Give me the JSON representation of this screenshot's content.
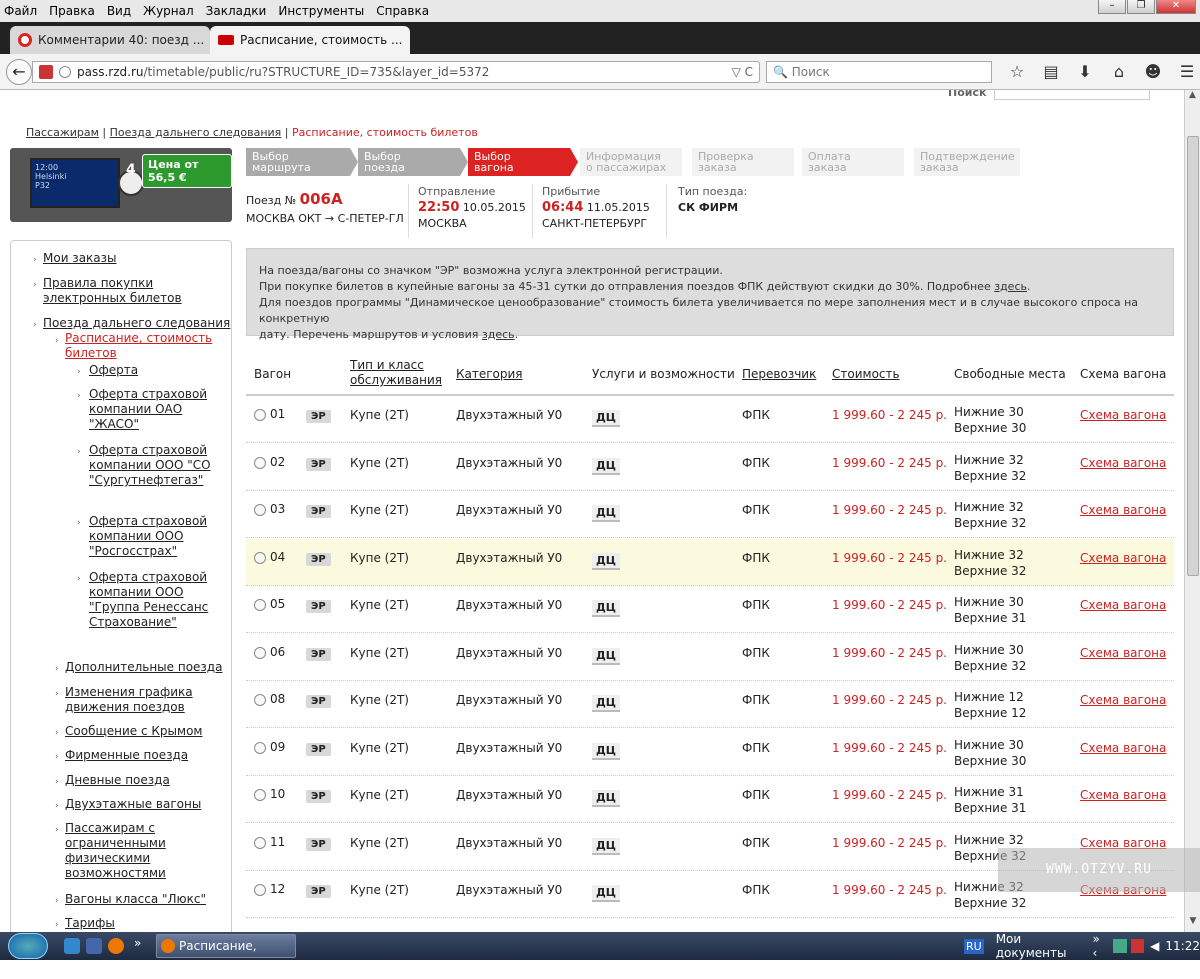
{
  "browser": {
    "menu": [
      "Файл",
      "Правка",
      "Вид",
      "Журнал",
      "Закладки",
      "Инструменты",
      "Справка"
    ],
    "tabs": [
      {
        "title": "Комментарии 40: поезд ...",
        "close": "×"
      },
      {
        "title": "Расписание, стоимость ...",
        "close": "×"
      }
    ],
    "new_tab": "+",
    "url_host": "pass.rzd.ru",
    "url_rest": "/timetable/public/ru?STRUCTURE_ID=735&layer_id=5372",
    "url_controls": "▽ C",
    "search_placeholder": "Поиск"
  },
  "site": {
    "top_search_label": "Поиск",
    "breadcrumb": [
      "Пассажирам",
      "Поезда дальнего следования",
      "Расписание, стоимость билетов"
    ],
    "promo": {
      "price": "Цена от 56,5 €",
      "city": "Helsinki",
      "time": "12:00",
      "platform": "P32",
      "track": "4"
    },
    "nav": [
      {
        "label": "Мои заказы"
      },
      {
        "label": "Правила покупки электронных билетов"
      },
      {
        "label": "Поезда дальнего следования"
      },
      {
        "label": "Расписание, стоимость билетов"
      },
      {
        "label": "Оферта"
      },
      {
        "label": "Оферта страховой компании ОАО \"ЖАСО\""
      },
      {
        "label": "Оферта страховой компании ООО \"СО \"Сургутнефтегаз\""
      },
      {
        "label": "Оферта страховой компании ООО \"Росгосстрах\""
      },
      {
        "label": "Оферта страховой компании ООО \"Группа Ренессанс Страхование\""
      },
      {
        "label": "Дополнительные поезда"
      },
      {
        "label": "Изменения графика движения поездов"
      },
      {
        "label": "Сообщение с Крымом"
      },
      {
        "label": "Фирменные поезда"
      },
      {
        "label": "Дневные поезда"
      },
      {
        "label": "Двухэтажные вагоны"
      },
      {
        "label": "Пассажирам с ограниченными физическими возможностями"
      },
      {
        "label": "Вагоны класса \"Люкс\""
      },
      {
        "label": "Тарифы"
      }
    ],
    "steps": [
      {
        "l1": "Выбор",
        "l2": "маршрута"
      },
      {
        "l1": "Выбор",
        "l2": "поезда"
      },
      {
        "l1": "Выбор",
        "l2": "вагона"
      },
      {
        "l1": "Информация",
        "l2": "о пассажирах"
      },
      {
        "l1": "Проверка",
        "l2": "заказа"
      },
      {
        "l1": "Оплата",
        "l2": "заказа"
      },
      {
        "l1": "Подтверждение",
        "l2": "заказа"
      }
    ],
    "train": {
      "label": "Поезд №",
      "number": "006А",
      "route": "МОСКВА ОКТ → С-ПЕТЕР-ГЛ",
      "dep_label": "Отправление",
      "dep_time": "22:50",
      "dep_date": "10.05.2015",
      "dep_city": "МОСКВА",
      "arr_label": "Прибытие",
      "arr_time": "06:44",
      "arr_date": "11.05.2015",
      "arr_city": "САНКТ-ПЕТЕРБУРГ",
      "type_label": "Тип поезда:",
      "type": "СК ФИРМ"
    },
    "notice": {
      "line1": "На поезда/вагоны со значком \"ЭР\" возможна услуга электронной регистрации.",
      "line2": "При покупке билетов в купейные вагоны за 45-31 сутки до отправления поездов ФПК действуют скидки до 30%. Подробнее",
      "line2_link": "здесь",
      "line3": "Для поездов программы \"Динамическое ценообразование\" стоимость билета увеличивается по мере заполнения мест и в случае высокого спроса на конкретную",
      "line4": "дату. Перечень маршрутов и условия",
      "line4_link": "здесь"
    },
    "table": {
      "headers": {
        "wagon": "Вагон",
        "type1": "Тип и класс",
        "type2": "обслуживания",
        "category": "Категория",
        "services": "Услуги и возможности",
        "carrier": "Перевозчик",
        "cost": "Стоимость",
        "seats": "Свободные места",
        "scheme": "Схема вагона"
      },
      "rows": [
        {
          "n": "01",
          "er": "ЭР",
          "type": "Купе (2Т)",
          "cat": "Двухэтажный У0",
          "svc": "ДЦ",
          "carrier": "ФПК",
          "price": "1 999.60 - 2 245 р.",
          "low": "Нижние 30",
          "up": "Верхние 30",
          "scheme": "Схема вагона"
        },
        {
          "n": "02",
          "er": "ЭР",
          "type": "Купе (2Т)",
          "cat": "Двухэтажный У0",
          "svc": "ДЦ",
          "carrier": "ФПК",
          "price": "1 999.60 - 2 245 р.",
          "low": "Нижние 32",
          "up": "Верхние 32",
          "scheme": "Схема вагона"
        },
        {
          "n": "03",
          "er": "ЭР",
          "type": "Купе (2Т)",
          "cat": "Двухэтажный У0",
          "svc": "ДЦ",
          "carrier": "ФПК",
          "price": "1 999.60 - 2 245 р.",
          "low": "Нижние 32",
          "up": "Верхние 32",
          "scheme": "Схема вагона"
        },
        {
          "n": "04",
          "er": "ЭР",
          "type": "Купе (2Т)",
          "cat": "Двухэтажный У0",
          "svc": "ДЦ",
          "carrier": "ФПК",
          "price": "1 999.60 - 2 245 р.",
          "low": "Нижние 32",
          "up": "Верхние 32",
          "scheme": "Схема вагона"
        },
        {
          "n": "05",
          "er": "ЭР",
          "type": "Купе (2Т)",
          "cat": "Двухэтажный У0",
          "svc": "ДЦ",
          "carrier": "ФПК",
          "price": "1 999.60 - 2 245 р.",
          "low": "Нижние 30",
          "up": "Верхние 31",
          "scheme": "Схема вагона"
        },
        {
          "n": "06",
          "er": "ЭР",
          "type": "Купе (2Т)",
          "cat": "Двухэтажный У0",
          "svc": "ДЦ",
          "carrier": "ФПК",
          "price": "1 999.60 - 2 245 р.",
          "low": "Нижние 30",
          "up": "Верхние 32",
          "scheme": "Схема вагона"
        },
        {
          "n": "08",
          "er": "ЭР",
          "type": "Купе (2Т)",
          "cat": "Двухэтажный У0",
          "svc": "ДЦ",
          "carrier": "ФПК",
          "price": "1 999.60 - 2 245 р.",
          "low": "Нижние 12",
          "up": "Верхние 12",
          "scheme": "Схема вагона"
        },
        {
          "n": "09",
          "er": "ЭР",
          "type": "Купе (2Т)",
          "cat": "Двухэтажный У0",
          "svc": "ДЦ",
          "carrier": "ФПК",
          "price": "1 999.60 - 2 245 р.",
          "low": "Нижние 30",
          "up": "Верхние 30",
          "scheme": "Схема вагона"
        },
        {
          "n": "10",
          "er": "ЭР",
          "type": "Купе (2Т)",
          "cat": "Двухэтажный У0",
          "svc": "ДЦ",
          "carrier": "ФПК",
          "price": "1 999.60 - 2 245 р.",
          "low": "Нижние 31",
          "up": "Верхние 31",
          "scheme": "Схема вагона"
        },
        {
          "n": "11",
          "er": "ЭР",
          "type": "Купе (2Т)",
          "cat": "Двухэтажный У0",
          "svc": "ДЦ",
          "carrier": "ФПК",
          "price": "1 999.60 - 2 245 р.",
          "low": "Нижние 32",
          "up": "Верхние 32",
          "scheme": "Схема вагона"
        },
        {
          "n": "12",
          "er": "ЭР",
          "type": "Купе (2Т)",
          "cat": "Двухэтажный У0",
          "svc": "ДЦ",
          "carrier": "ФПК",
          "price": "1 999.60 - 2 245 р.",
          "low": "Нижние 32",
          "up": "Верхние 32",
          "scheme": "Схема вагона"
        }
      ]
    }
  },
  "watermark": "WWW.OTZYV.RU",
  "taskbar": {
    "task": "Расписание, стоим...",
    "lang": "RU",
    "docs": "Мои документы",
    "clock": "11:22"
  },
  "colors": {
    "accent_red": "#cc2222",
    "highlight_row": "#fbfadf",
    "notice_bg": "#dddddd"
  }
}
